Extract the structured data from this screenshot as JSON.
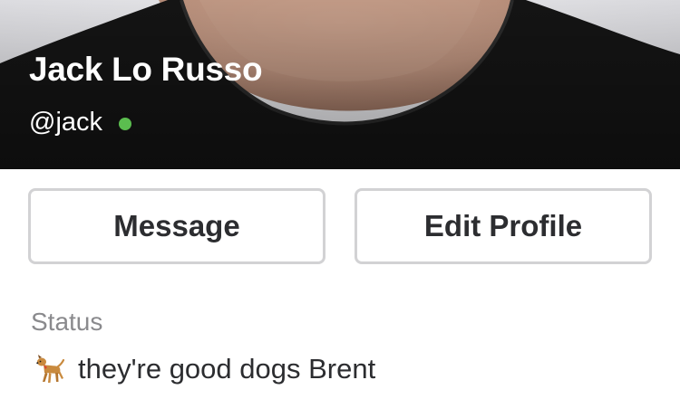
{
  "profile": {
    "name": "Jack Lo Russo",
    "handle": "@jack",
    "presence": "active",
    "presence_color": "#5bbd4f"
  },
  "actions": {
    "message_label": "Message",
    "edit_profile_label": "Edit Profile"
  },
  "status": {
    "label": "Status",
    "icon": "dog-icon",
    "text": "they're good dogs Brent"
  },
  "colors": {
    "button_border": "#d2d2d4",
    "text_primary": "#2c2d30",
    "text_secondary": "#8a8a8d"
  }
}
